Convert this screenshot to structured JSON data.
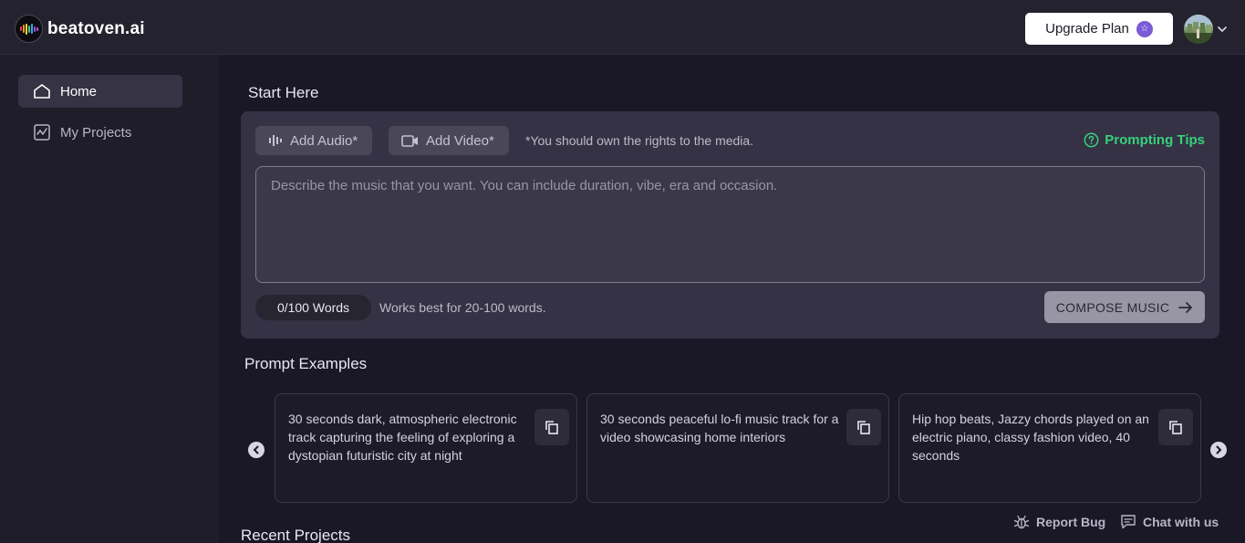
{
  "header": {
    "logo_text": "beatoven.ai",
    "upgrade_label": "Upgrade Plan",
    "icons": {
      "upgrade": "star-badge-icon",
      "avatar_menu": "chevron-down-icon"
    }
  },
  "sidebar": {
    "items": [
      {
        "label": "Home",
        "icon": "home-icon",
        "active": true
      },
      {
        "label": "My Projects",
        "icon": "chart-box-icon",
        "active": false
      }
    ]
  },
  "start": {
    "title": "Start Here",
    "add_audio_label": "Add Audio*",
    "add_video_label": "Add Video*",
    "rights_note": "*You should own the rights to the media.",
    "tips_label": "Prompting Tips",
    "prompt_placeholder": "Describe the music that you want. You can include duration, vibe, era and occasion.",
    "word_count": "0/100 Words",
    "word_hint": "Works best for 20-100 words.",
    "compose_label": "COMPOSE MUSIC",
    "colors": {
      "tips": "#38d07d",
      "panel": "#343244"
    }
  },
  "examples": {
    "title": "Prompt Examples",
    "items": [
      "30 seconds dark, atmospheric electronic track capturing the feeling of exploring a dystopian futuristic city at night",
      "30 seconds peaceful lo-fi music track for a video showcasing home interiors",
      "Hip hop beats, Jazzy chords played on an electric piano, classy fashion video, 40 seconds"
    ]
  },
  "recent": {
    "title": "Recent Projects"
  },
  "footer": {
    "report_bug_label": "Report Bug",
    "chat_label": "Chat with us"
  }
}
